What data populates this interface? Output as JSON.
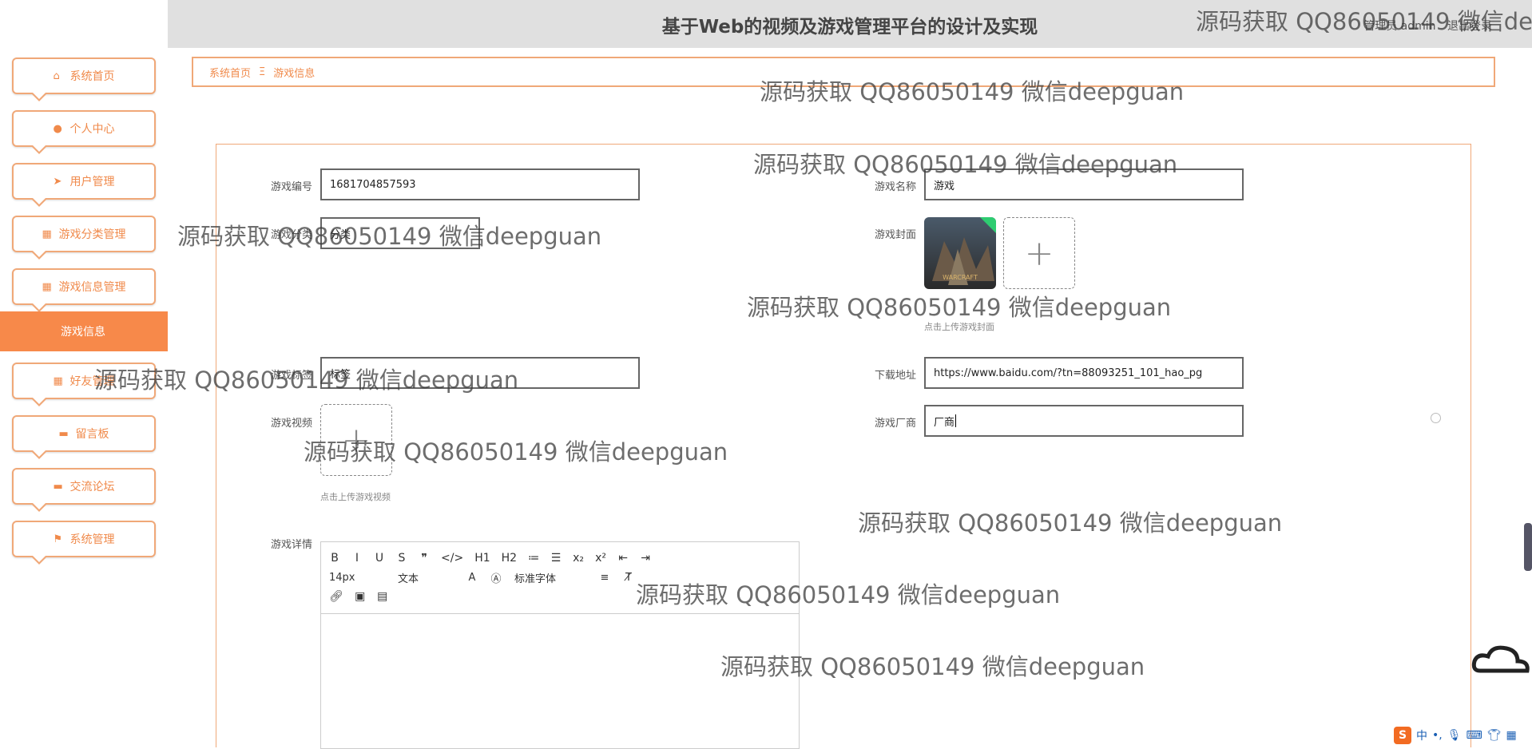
{
  "header": {
    "title": "基于Web的视频及游戏管理平台的设计及实现",
    "user_label": "管理员 admin",
    "logout": "退出登录"
  },
  "sidebar": {
    "items": [
      {
        "label": "系统首页",
        "icon": "home-icon"
      },
      {
        "label": "个人中心",
        "icon": "user-icon"
      },
      {
        "label": "用户管理",
        "icon": "send-icon"
      },
      {
        "label": "游戏分类管理",
        "icon": "grid-icon"
      },
      {
        "label": "游戏信息管理",
        "icon": "grid-icon"
      },
      {
        "label": "好友管理",
        "icon": "grid-icon"
      },
      {
        "label": "留言板",
        "icon": "monitor-icon"
      },
      {
        "label": "交流论坛",
        "icon": "monitor-icon"
      },
      {
        "label": "系统管理",
        "icon": "flag-icon"
      }
    ],
    "active_sub": "游戏信息"
  },
  "breadcrumb": {
    "home": "系统首页",
    "sep": "Ξ",
    "current": "游戏信息"
  },
  "form": {
    "game_no": {
      "label": "游戏编号",
      "value": "1681704857593"
    },
    "game_name": {
      "label": "游戏名称",
      "value": "游戏"
    },
    "category": {
      "label": "游戏分类",
      "value": "分类"
    },
    "cover": {
      "label": "游戏封面",
      "hint": "点击上传游戏封面"
    },
    "tag": {
      "label": "游戏标签",
      "value": "标签"
    },
    "download": {
      "label": "下载地址",
      "value": "https://www.baidu.com/?tn=88093251_101_hao_pg"
    },
    "video": {
      "label": "游戏视频",
      "hint": "点击上传游戏视频"
    },
    "vendor": {
      "label": "游戏厂商",
      "value": "厂商"
    },
    "detail": {
      "label": "游戏详情"
    }
  },
  "editor": {
    "row1": [
      "B",
      "I",
      "U",
      "S",
      "❞",
      "</>",
      "H1",
      "H2",
      "≔",
      "☰",
      "x₂",
      "x²",
      "⇤",
      "⇥"
    ],
    "font_size": "14px",
    "text_type": "文本",
    "font_family": "标准字体"
  },
  "watermark": "源码获取 QQ86050149 微信deepguan",
  "watermark_top": "源码获取 QQ86050149 微信de",
  "colors": {
    "accent": "#f7894a",
    "border": "#f0a878"
  }
}
